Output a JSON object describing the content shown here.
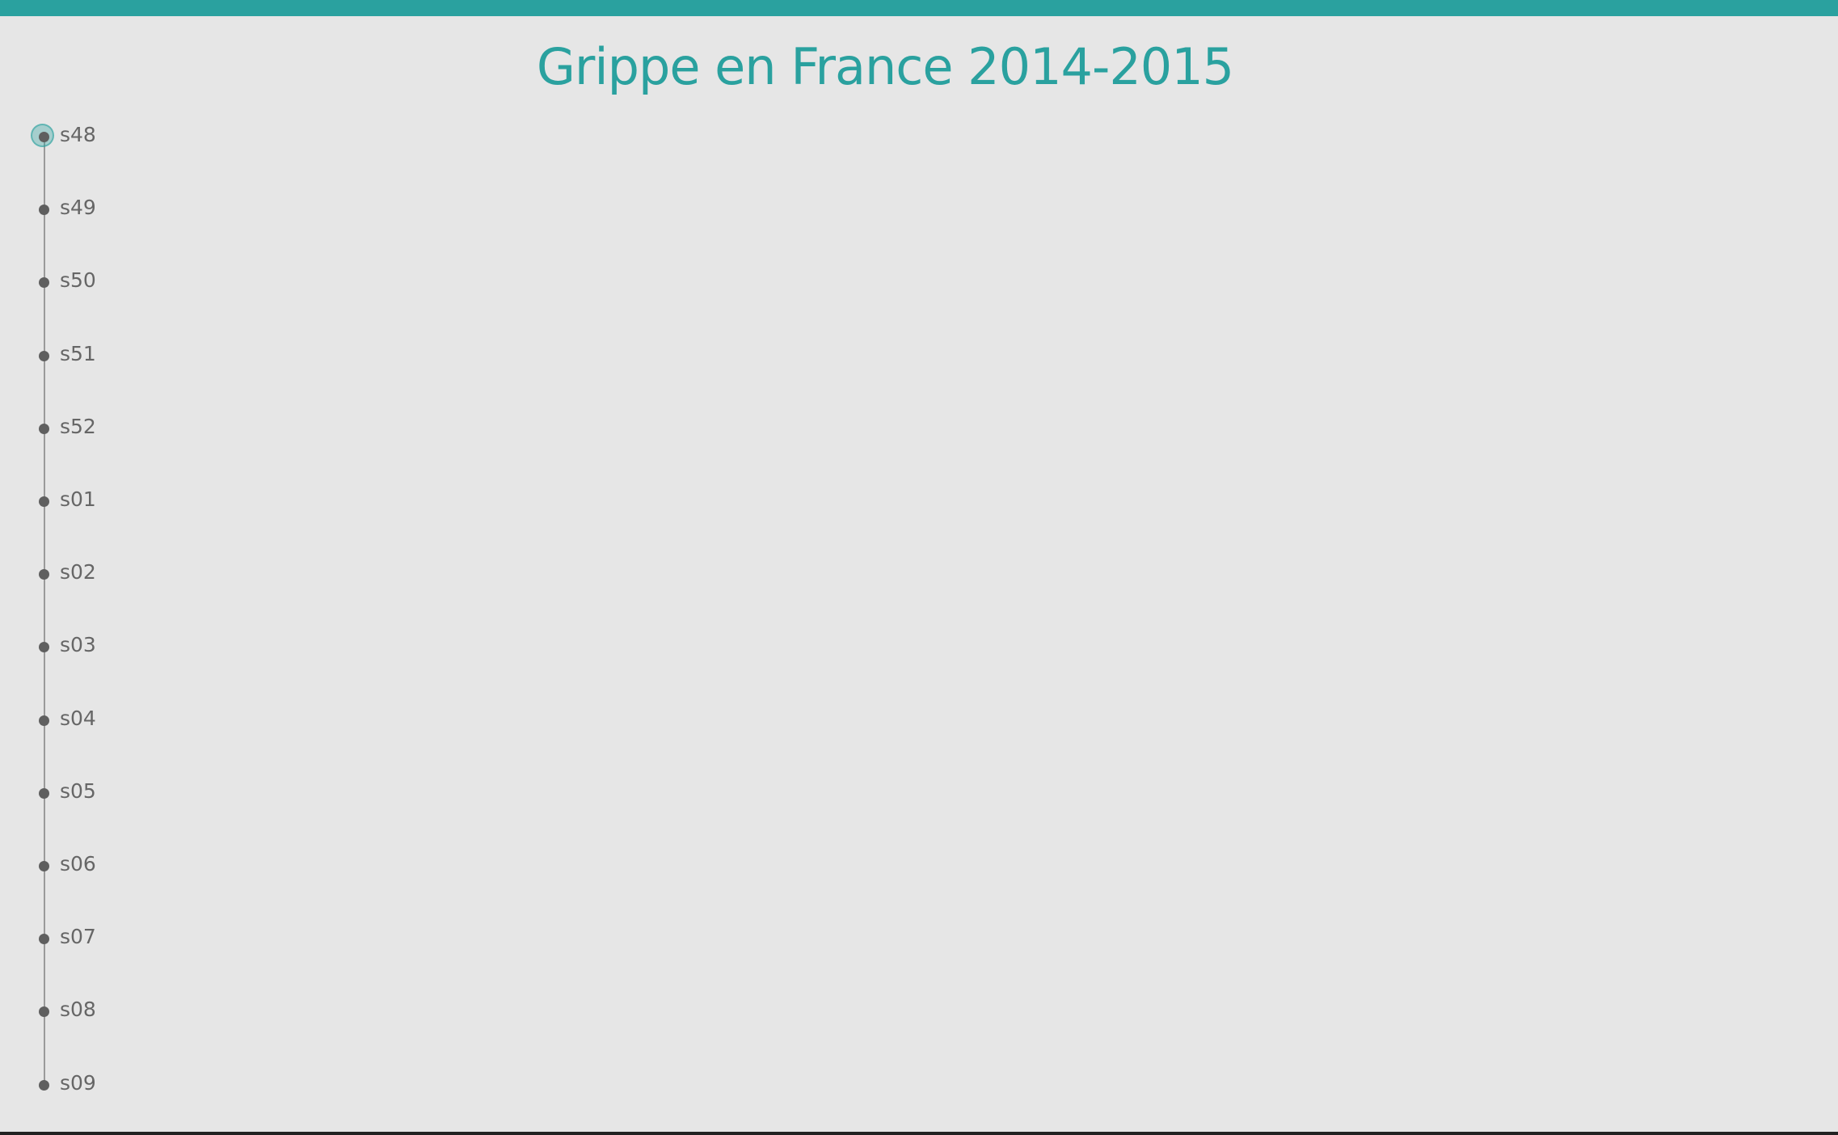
{
  "header": {
    "title": "Grippe en France 2014-2015"
  },
  "colors": {
    "accent": "#2aa19f",
    "background": "#e6e6e6",
    "dot": "#5f5f5f",
    "label": "#666666"
  },
  "timeline": {
    "selected_index": 0,
    "weeks": [
      {
        "label": "s48"
      },
      {
        "label": "s49"
      },
      {
        "label": "s50"
      },
      {
        "label": "s51"
      },
      {
        "label": "s52"
      },
      {
        "label": "s01"
      },
      {
        "label": "s02"
      },
      {
        "label": "s03"
      },
      {
        "label": "s04"
      },
      {
        "label": "s05"
      },
      {
        "label": "s06"
      },
      {
        "label": "s07"
      },
      {
        "label": "s08"
      },
      {
        "label": "s09"
      }
    ]
  }
}
